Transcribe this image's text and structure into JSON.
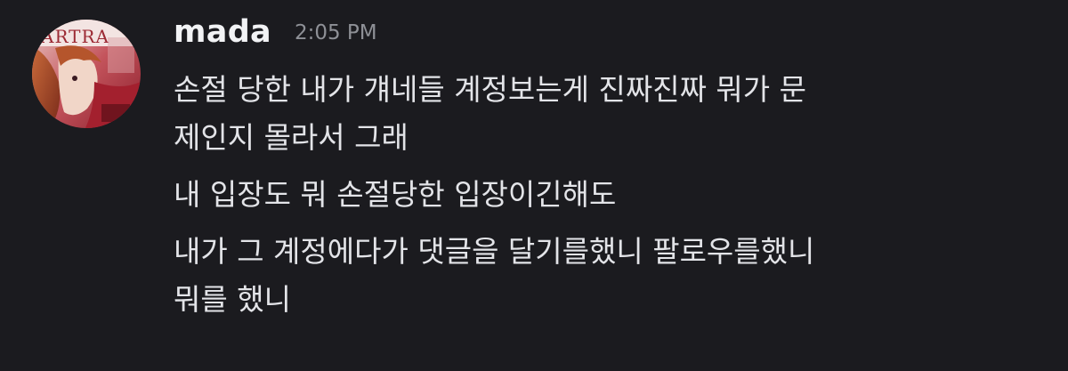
{
  "message": {
    "author": "mada",
    "timestamp": "2:05 PM",
    "avatar_icon": "user-avatar",
    "lines": [
      "손절 당한 내가 걔네들 계정보는게 진짜진짜 뭐가 문\n제인지 몰라서 그래",
      "내 입장도 뭐 손절당한 입장이긴해도",
      "내가 그 계정에다가 댓글을 달기를했니 팔로우를했니\n뭐를 했니"
    ]
  },
  "colors": {
    "background": "#1b1b1f",
    "username": "#f2f3f5",
    "timestamp": "#8e9096",
    "message_text": "#e3e4e8"
  }
}
